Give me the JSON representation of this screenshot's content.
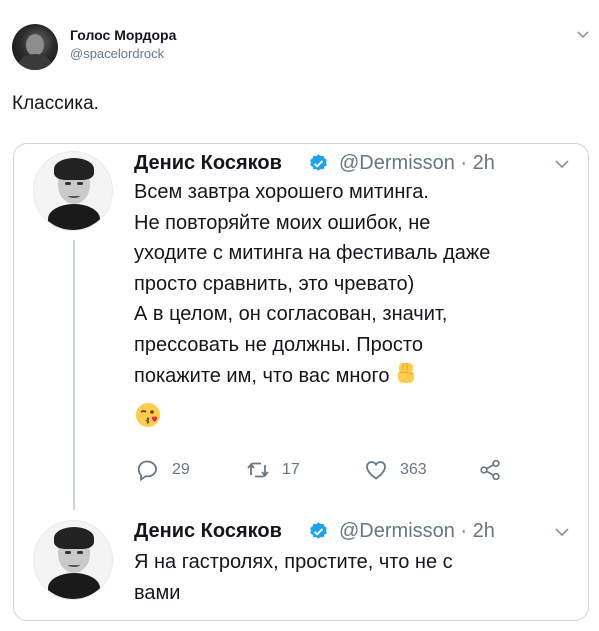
{
  "outer": {
    "display_name": "Голос Мордора",
    "handle": "@spacelordrock",
    "text": "Классика."
  },
  "thread": [
    {
      "display_name": "Денис Косяков",
      "handle_time": "@Dermisson · 2h",
      "lines": [
        "Всем завтра хорошего митинга.",
        "Не повторяйте моих ошибок, не",
        "уходите с митинга на фестиваль даже",
        "просто сравнить, это чревато)",
        "А в целом, он согласован, значит,",
        "прессовать не должны. Просто",
        "покажите им, что вас много"
      ],
      "emojis": [
        "raised-fist-emoji",
        "kissing-wink-emoji"
      ],
      "actions": {
        "replies": "29",
        "retweets": "17",
        "likes": "363"
      }
    },
    {
      "display_name": "Денис Косяков",
      "handle_time": "@Dermisson · 2h",
      "lines": [
        "Я на гастролях, простите, что не с",
        "вами"
      ]
    }
  ],
  "icons": {
    "reply": "reply-icon",
    "retweet": "retweet-icon",
    "like": "heart-icon",
    "share": "share-icon",
    "verified": "verified-badge-icon",
    "caret": "chevron-down-icon"
  },
  "colors": {
    "verified_blue": "#1da1f2",
    "muted_gray": "#657786",
    "border": "#ccd6dd",
    "text": "#14171a"
  }
}
